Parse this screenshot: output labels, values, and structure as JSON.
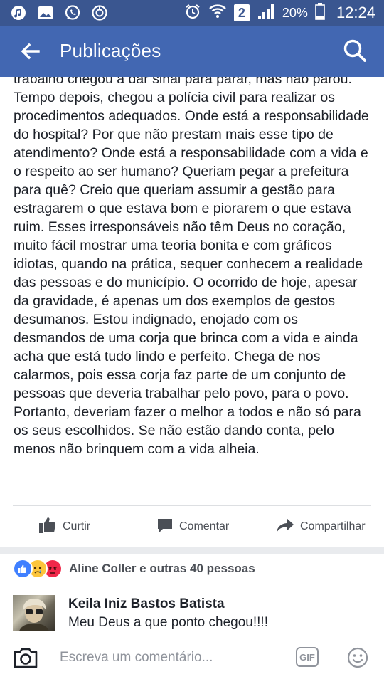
{
  "status_bar": {
    "left_icons": [
      "music-icon",
      "gallery-icon",
      "whatsapp-icon",
      "sync-icon"
    ],
    "right_icons": [
      "alarm-icon",
      "wifi-icon",
      "sim2-icon",
      "signal-icon",
      "battery-icon"
    ],
    "sim_label": "2",
    "battery": "20%",
    "time": "12:24"
  },
  "app_bar": {
    "title": "Publicações",
    "back_icon": "arrow-left-icon",
    "search_icon": "search-icon"
  },
  "post": {
    "paragraph": "trabalho chegou a dar sinal para parar, mas não parou. Tempo depois, chegou a polícia civil para realizar os procedimentos adequados. Onde está a responsabilidade do hospital? Por que não prestam mais esse tipo de atendimento? Onde está a responsabilidade com a vida e o respeito ao ser humano? Queriam pegar a prefeitura para quê? Creio que queriam assumir a gestão para estragarem o que estava bom e piorarem o que estava ruim. Esses irresponsáveis não têm Deus no coração, muito fácil mostrar uma teoria bonita e com gráficos idiotas, quando na prática, sequer conhecem a realidade das pessoas e do município. O ocorrido de hoje, apesar da gravidade, é apenas um dos exemplos de gestos desumanos. Estou indignado, enojado com os desmandos de uma corja que brinca com a vida e ainda acha que está tudo lindo e perfeito. Chega de nos calarmos, pois essa corja faz parte de um conjunto de pessoas que deveria trabalhar pelo povo, para o povo. Portanto, deveriam fazer o melhor a todos e não só para os seus escolhidos. Se não estão dando conta, pelo menos não brinquem com a vida alheia."
  },
  "actions": {
    "like": "Curtir",
    "comment": "Comentar",
    "share": "Compartilhar"
  },
  "reactions": {
    "icons": [
      "like-reaction-icon",
      "sad-reaction-icon",
      "angry-reaction-icon"
    ],
    "summary": "Aline Coller e outras 40 pessoas"
  },
  "comment": {
    "author": "Keila Iniz Bastos Batista",
    "text": "Meu Deus a que ponto chegou!!!!"
  },
  "composer": {
    "placeholder": "Escreva um comentário...",
    "camera_icon": "camera-icon",
    "gif_label": "GIF",
    "emoji_icon": "smiley-icon"
  },
  "colors": {
    "status_bar": "#3a5690",
    "app_bar": "#4267b2",
    "like_blue": "#4080ff",
    "angry_red": "#f0284a",
    "sad_yellow": "#fcc53c"
  }
}
